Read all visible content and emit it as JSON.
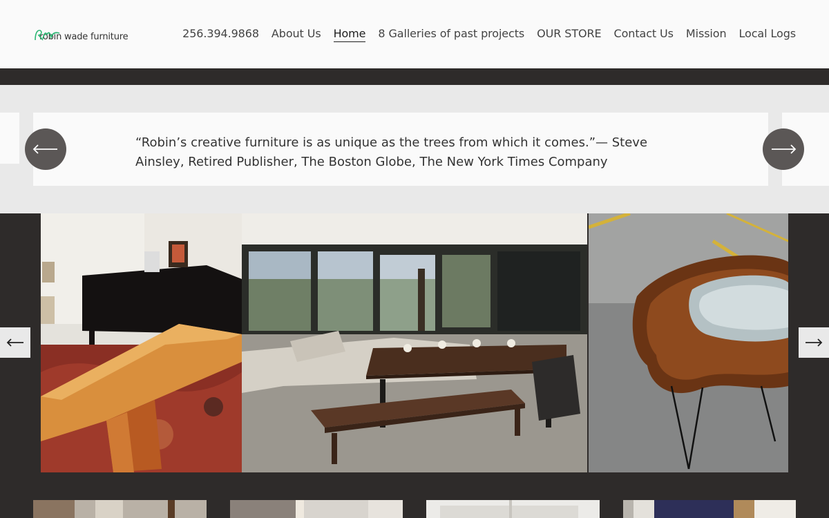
{
  "header": {
    "logo_text": "robin wade furniture",
    "nav": [
      {
        "label": "256.394.9868"
      },
      {
        "label": "About Us"
      },
      {
        "label": "Home"
      },
      {
        "label": "8 Galleries of past projects"
      },
      {
        "label": "OUR STORE"
      },
      {
        "label": "Contact Us"
      },
      {
        "label": "Mission"
      },
      {
        "label": "Local Logs"
      }
    ],
    "active_nav": "Home"
  },
  "testimonial": {
    "quote": "“Robin’s creative furniture is as unique as the trees from which it comes.”— Steve Ainsley, Retired Publisher, The Boston Globe, The New York Times Company",
    "prev_icon": "arrow-left-icon",
    "next_icon": "arrow-right-icon"
  },
  "gallery": {
    "photos": [
      {
        "name": "live-edge-bench-photo"
      },
      {
        "name": "dining-room-table-photo"
      },
      {
        "name": "river-glass-table-photo"
      }
    ],
    "prev_icon": "arrow-left-icon",
    "next_icon": "arrow-right-icon"
  },
  "thumbnails": 4,
  "colors": {
    "header_bg": "#fafafa",
    "dark_bg": "#2e2b2a",
    "band_bg": "#e9e9e9",
    "button_bg": "#5b5756",
    "logo_accent": "#2bb673"
  }
}
